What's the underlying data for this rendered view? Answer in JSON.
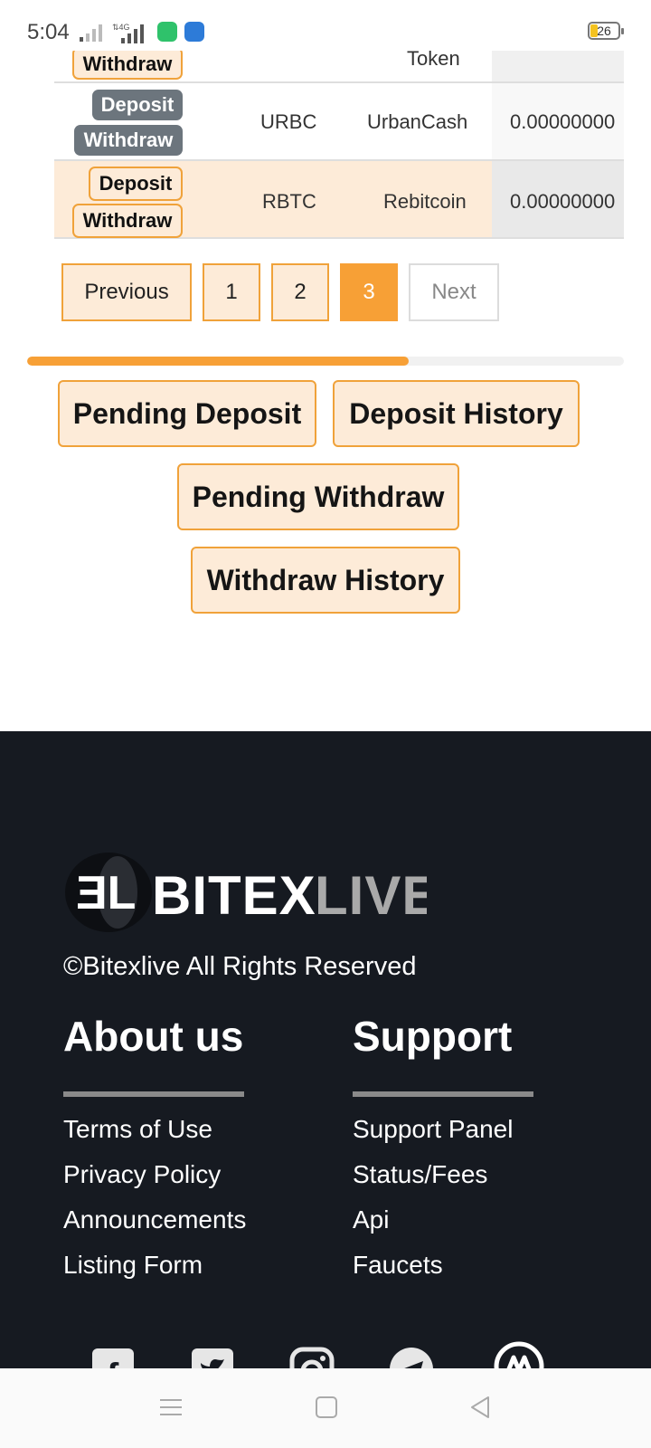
{
  "status_bar": {
    "time": "5:04",
    "battery": "26"
  },
  "table": {
    "rows": [
      {
        "symbol": "",
        "name": "Token",
        "balance": "",
        "deposit_label": "",
        "withdraw_label": "Withdraw"
      },
      {
        "symbol": "URBC",
        "name": "UrbanCash",
        "balance": "0.00000000",
        "deposit_label": "Deposit",
        "withdraw_label": "Withdraw"
      },
      {
        "symbol": "RBTC",
        "name": "Rebitcoin",
        "balance": "0.00000000",
        "deposit_label": "Deposit",
        "withdraw_label": "Withdraw"
      }
    ]
  },
  "pagination": {
    "previous": "Previous",
    "pages": [
      "1",
      "2",
      "3"
    ],
    "active_page": "3",
    "next": "Next"
  },
  "progress": {
    "value_percent": 64
  },
  "actions": {
    "pending_deposit": "Pending Deposit",
    "deposit_history": "Deposit History",
    "pending_withdraw": "Pending Withdraw",
    "withdraw_history": "Withdraw History"
  },
  "footer": {
    "logo_text": "BITEXLIVE",
    "copyright": "©Bitexlive All Rights Reserved",
    "about": {
      "title": "About us",
      "links": [
        "Terms of Use",
        "Privacy Policy",
        "Announcements",
        "Listing Form"
      ]
    },
    "support": {
      "title": "Support",
      "links": [
        "Support Panel",
        "Status/Fees",
        "Api",
        "Faucets"
      ]
    },
    "social_icons": [
      "facebook-icon",
      "twitter-icon",
      "instagram-icon",
      "telegram-icon",
      "coinmarketcap-icon"
    ]
  },
  "colors": {
    "accent": "#f7a036",
    "accent_light": "#fdebd8",
    "footer_bg": "#161a21",
    "dark_button": "#6c757d"
  }
}
